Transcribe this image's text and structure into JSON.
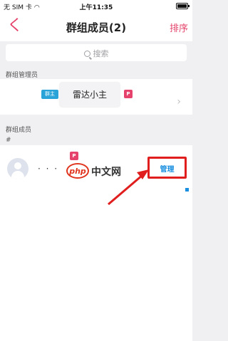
{
  "status_bar": {
    "carrier": "无 SIM 卡",
    "time": "上午11:35",
    "battery_level": 0.85
  },
  "nav": {
    "back_label": "く",
    "title": "群组成员(2)",
    "sort_label": "排序"
  },
  "search": {
    "placeholder": "搜索"
  },
  "admins": {
    "section_label": "群组管理员",
    "items": [
      {
        "badge": "群主",
        "name": "雷达小主",
        "p_badge": "P"
      }
    ]
  },
  "members": {
    "section_label": "群组成员",
    "index_letter": "#",
    "items": [
      {
        "name": "· · ·",
        "p_badge": "P",
        "action_label": "管理"
      }
    ]
  },
  "watermark": {
    "logo": "php",
    "text": "中文网"
  },
  "colors": {
    "accent": "#e5436b",
    "badge_blue": "#2aa4d8",
    "highlight_red": "#e01e1e",
    "link_blue": "#1a8fe0"
  }
}
